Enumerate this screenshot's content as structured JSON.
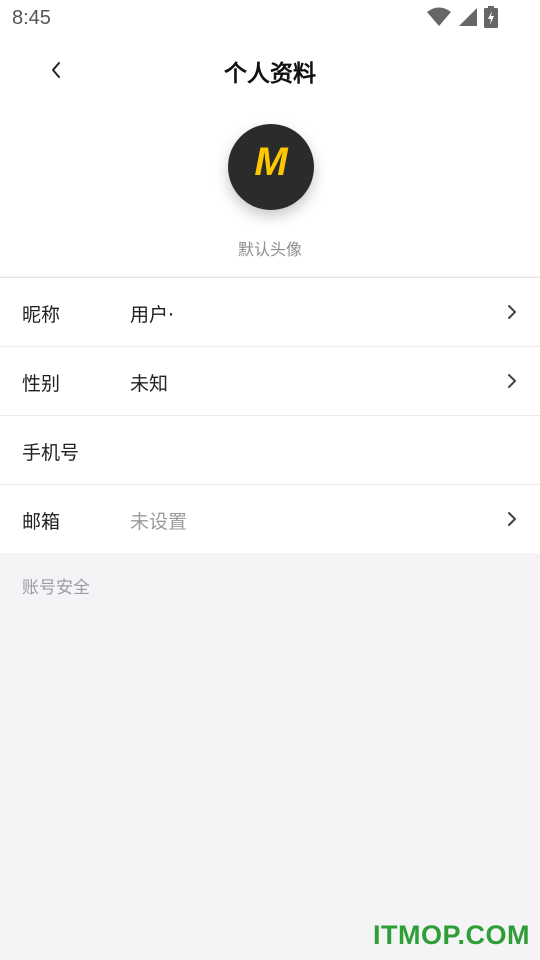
{
  "status_bar": {
    "time": "8:45",
    "icons": [
      "wifi-icon",
      "cellular-signal-icon",
      "battery-charging-icon"
    ]
  },
  "nav": {
    "back_icon": "chevron-left-icon",
    "title": "个人资料"
  },
  "profile": {
    "avatar_letter": "M",
    "avatar_caption": "默认头像",
    "avatar_bg": "#2b2b2b",
    "avatar_letter_color": "#ffc700"
  },
  "rows": [
    {
      "label": "昵称",
      "value": "用户·",
      "has_arrow": true
    },
    {
      "label": "性别",
      "value": "未知",
      "has_arrow": true
    },
    {
      "label": "手机号",
      "value": "",
      "has_arrow": false
    },
    {
      "label": "邮箱",
      "value": "未设置",
      "has_arrow": true
    }
  ],
  "section": {
    "account_security": "账号安全"
  },
  "watermark": "ITMOP.COM"
}
